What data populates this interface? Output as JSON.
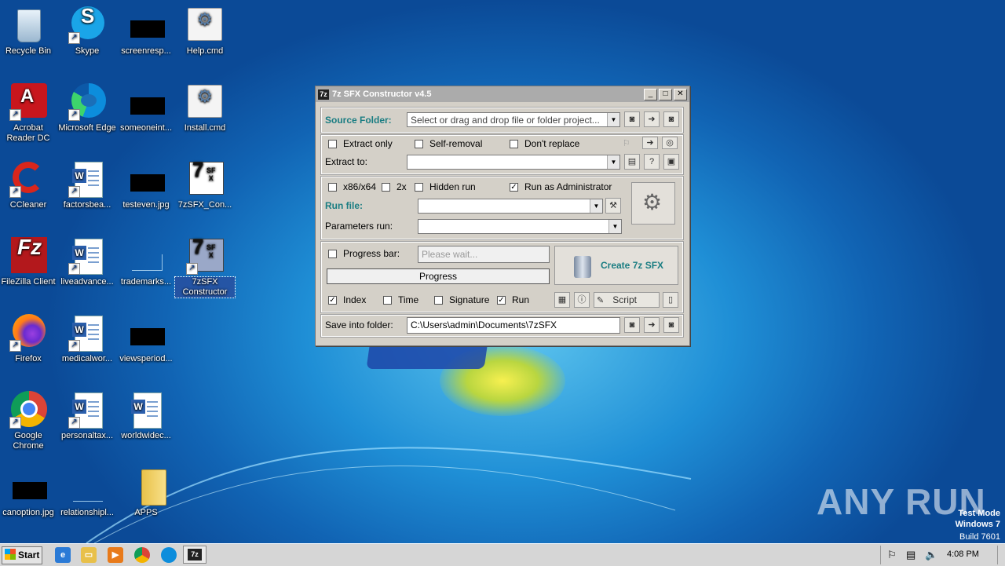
{
  "desktop_icons": [
    {
      "label": "Recycle Bin"
    },
    {
      "label": "Skype"
    },
    {
      "label": "screenresp..."
    },
    {
      "label": "Help.cmd"
    },
    {
      "label": "Acrobat Reader DC"
    },
    {
      "label": "Microsoft Edge"
    },
    {
      "label": "someoneint..."
    },
    {
      "label": "Install.cmd"
    },
    {
      "label": "CCleaner"
    },
    {
      "label": "factorsbea..."
    },
    {
      "label": "testeven.jpg"
    },
    {
      "label": "7zSFX_Con..."
    },
    {
      "label": "FileZilla Client"
    },
    {
      "label": "liveadvance..."
    },
    {
      "label": "trademarks..."
    },
    {
      "label": "7zSFX Constructor"
    },
    {
      "label": "Firefox"
    },
    {
      "label": "medicalwor..."
    },
    {
      "label": "viewsperiod..."
    },
    {
      "label": "Google Chrome"
    },
    {
      "label": "personaltax..."
    },
    {
      "label": "worldwidec..."
    },
    {
      "label": "canoption.jpg"
    },
    {
      "label": "relationshipl..."
    },
    {
      "label": "APPS"
    }
  ],
  "window": {
    "title": "7z SFX Constructor v4.5",
    "source_label": "Source Folder:",
    "source_placeholder": "Select or drag and drop file or folder project...",
    "extract_only": "Extract only",
    "self_removal": "Self-removal",
    "dont_replace": "Don't replace",
    "extract_to": "Extract to:",
    "x86x64": "x86/x64",
    "twox": "2x",
    "hidden_run": "Hidden run",
    "run_admin": "Run as Administrator",
    "run_file": "Run file:",
    "params_run": "Parameters run:",
    "progress_bar": "Progress bar:",
    "please_wait": "Please wait...",
    "progress": "Progress",
    "create": "Create 7z SFX",
    "index": "Index",
    "time": "Time",
    "signature": "Signature",
    "run": "Run",
    "script": "Script",
    "save_label": "Save into folder:",
    "save_value": "C:\\Users\\admin\\Documents\\7zSFX",
    "check_mark": "✓",
    "app_icon": "7z"
  },
  "taskbar": {
    "start": "Start",
    "time": "4:08 PM",
    "active_app": "7z"
  },
  "watermark": {
    "brand": "ANY RUN",
    "line1": "Test Mode",
    "line2": "Windows 7",
    "line3": "Build 7601"
  }
}
